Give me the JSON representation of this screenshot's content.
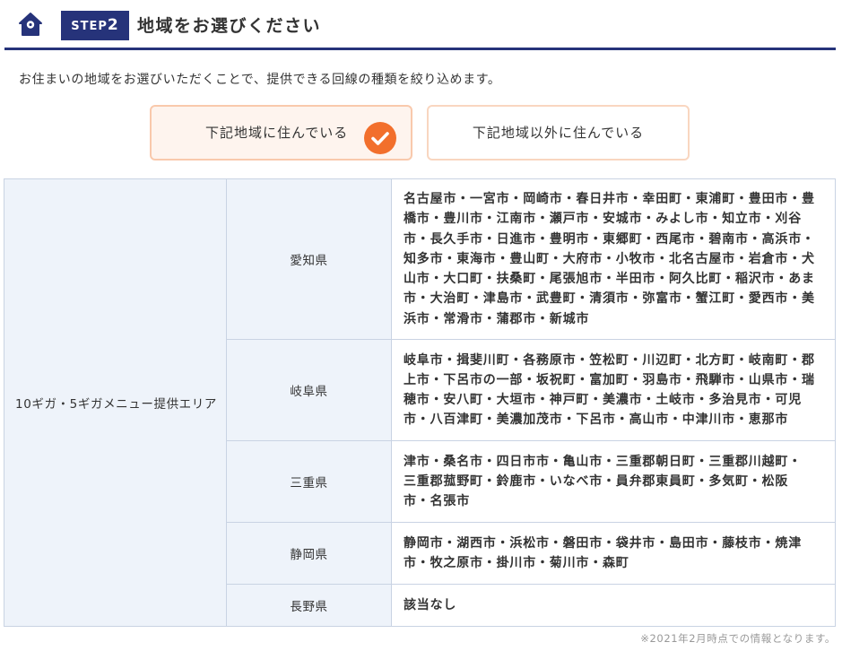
{
  "header": {
    "home_icon": "home-icon",
    "step_label": "STEP",
    "step_number": "2",
    "title": "地域をお選びください",
    "accent_color": "#26337a"
  },
  "intro": "お住まいの地域をお選びいただくことで、提供できる回線の種類を絞り込めます。",
  "choices": [
    {
      "label": "下記地域に住んでいる",
      "selected": true,
      "check_icon": "check-circle-icon",
      "check_color": "#f26f2c"
    },
    {
      "label": "下記地域以外に住んでいる",
      "selected": false
    }
  ],
  "table": {
    "area_label": "10ギガ・5ギガメニュー提供エリア",
    "rows": [
      {
        "prefecture": "愛知県",
        "lines": [
          "名古屋市・一宮市・岡崎市・春日井市・幸田町・東浦町・豊田市・豊",
          "橋市・豊川市・江南市・瀬戸市・安城市・みよし市・知立市・刈谷",
          "市・長久手市・日進市・豊明市・東郷町・西尾市・碧南市・高浜市・",
          "知多市・東海市・豊山町・大府市・小牧市・北名古屋市・岩倉市・犬",
          "山市・大口町・扶桑町・尾張旭市・半田市・阿久比町・稲沢市・あま",
          "市・大治町・津島市・武豊町・清須市・弥富市・蟹江町・愛西市・美",
          "浜市・常滑市・蒲郡市・新城市"
        ]
      },
      {
        "prefecture": "岐阜県",
        "lines": [
          "岐阜市・揖斐川町・各務原市・笠松町・川辺町・北方町・岐南町・郡",
          "上市・下呂市の一部・坂祝町・富加町・羽島市・飛騨市・山県市・瑞",
          "穂市・安八町・大垣市・神戸町・美濃市・土岐市・多治見市・可児",
          "市・八百津町・美濃加茂市・下呂市・高山市・中津川市・恵那市"
        ]
      },
      {
        "prefecture": "三重県",
        "lines": [
          "津市・桑名市・四日市市・亀山市・三重郡朝日町・三重郡川越町・",
          "三重郡菰野町・鈴鹿市・いなべ市・員弁郡東員町・多気町・松阪",
          "市・名張市"
        ]
      },
      {
        "prefecture": "静岡県",
        "lines": [
          "静岡市・湖西市・浜松市・磐田市・袋井市・島田市・藤枝市・焼津",
          "市・牧之原市・掛川市・菊川市・森町"
        ]
      },
      {
        "prefecture": "長野県",
        "lines": [
          "該当なし"
        ]
      }
    ]
  },
  "footnote": "※2021年2月時点での情報となります。"
}
